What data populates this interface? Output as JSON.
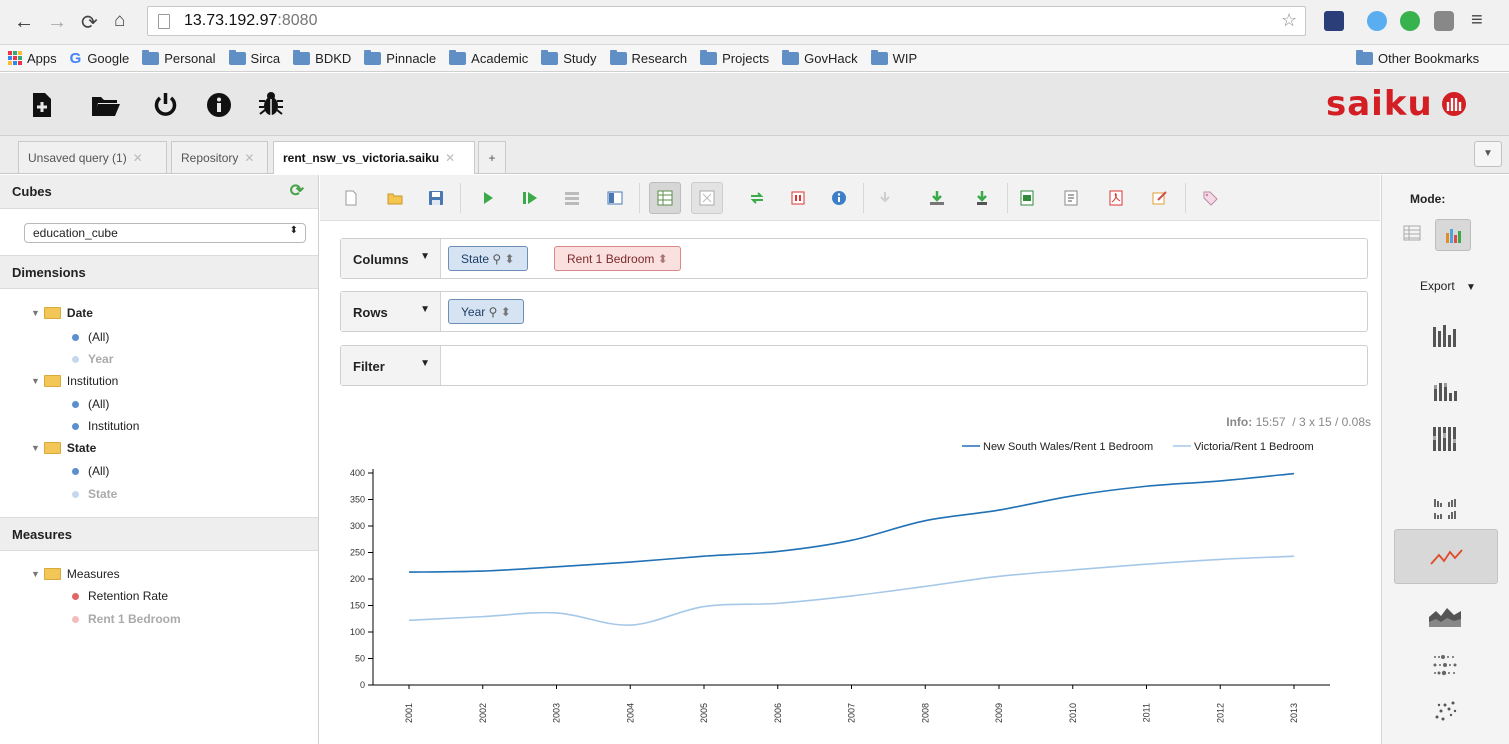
{
  "browser": {
    "url_host": "13.73.192.97",
    "url_port": ":8080"
  },
  "bookmarks": [
    {
      "label": "Apps",
      "icon": "apps-grid-icon"
    },
    {
      "label": "Google",
      "icon": "google-g-icon"
    },
    {
      "label": "Personal",
      "icon": "folder-icon"
    },
    {
      "label": "Sirca",
      "icon": "folder-icon"
    },
    {
      "label": "BDKD",
      "icon": "folder-icon"
    },
    {
      "label": "Pinnacle",
      "icon": "folder-icon"
    },
    {
      "label": "Academic",
      "icon": "folder-icon"
    },
    {
      "label": "Study",
      "icon": "folder-icon"
    },
    {
      "label": "Research",
      "icon": "folder-icon"
    },
    {
      "label": "Projects",
      "icon": "folder-icon"
    },
    {
      "label": "GovHack",
      "icon": "folder-icon"
    },
    {
      "label": "WIP",
      "icon": "folder-icon"
    }
  ],
  "other_bookmarks": "Other Bookmarks",
  "app": {
    "logo_text": "saiku"
  },
  "tabs": [
    {
      "label": "Unsaved query (1)"
    },
    {
      "label": "Repository"
    },
    {
      "label": "rent_nsw_vs_victoria.saiku"
    },
    {
      "label": "+"
    }
  ],
  "sidebar": {
    "cubes_title": "Cubes",
    "cube_selected": "education_cube",
    "dimensions_title": "Dimensions",
    "dimensions": [
      {
        "name": "Date",
        "bold": true,
        "levels": [
          {
            "label": "(All)",
            "used": false
          },
          {
            "label": "Year",
            "used": true
          }
        ]
      },
      {
        "name": "Institution",
        "bold": false,
        "levels": [
          {
            "label": "(All)",
            "used": false
          },
          {
            "label": "Institution",
            "used": false
          }
        ]
      },
      {
        "name": "State",
        "bold": true,
        "levels": [
          {
            "label": "(All)",
            "used": false
          },
          {
            "label": "State",
            "used": true
          }
        ]
      }
    ],
    "measures_title": "Measures",
    "measures_group": "Measures",
    "measures": [
      {
        "label": "Retention Rate",
        "used": false
      },
      {
        "label": "Rent 1 Bedroom",
        "used": true
      }
    ]
  },
  "query": {
    "columns_label": "Columns",
    "columns": [
      "State",
      "Rent 1 Bedroom"
    ],
    "rows_label": "Rows",
    "rows": [
      "Year"
    ],
    "filter_label": "Filter",
    "info_label": "Info:",
    "info_value": "15:57  / 3 x 15 / 0.08s"
  },
  "rightbar": {
    "mode_label": "Mode:",
    "export_label": "Export"
  },
  "colors": {
    "nsw": "#2171b5",
    "vic": "#a6c8e8",
    "chart_active": "#e04a2a",
    "logo": "#d31e23"
  },
  "chart_data": {
    "type": "line",
    "x": [
      "2001",
      "2002",
      "2003",
      "2004",
      "2005",
      "2006",
      "2007",
      "2008",
      "2009",
      "2010",
      "2011",
      "2012",
      "2013"
    ],
    "series": [
      {
        "name": "New South Wales/Rent 1 Bedroom",
        "values": [
          213,
          215,
          223,
          232,
          243,
          252,
          273,
          310,
          330,
          357,
          375,
          385,
          399
        ]
      },
      {
        "name": "Victoria/Rent 1 Bedroom",
        "values": [
          122,
          129,
          136,
          113,
          148,
          154,
          168,
          186,
          205,
          217,
          228,
          237,
          243
        ]
      }
    ],
    "ylim": [
      0,
      400
    ],
    "yticks": [
      0,
      50,
      100,
      150,
      200,
      250,
      300,
      350,
      400
    ],
    "legend": "top-right"
  }
}
